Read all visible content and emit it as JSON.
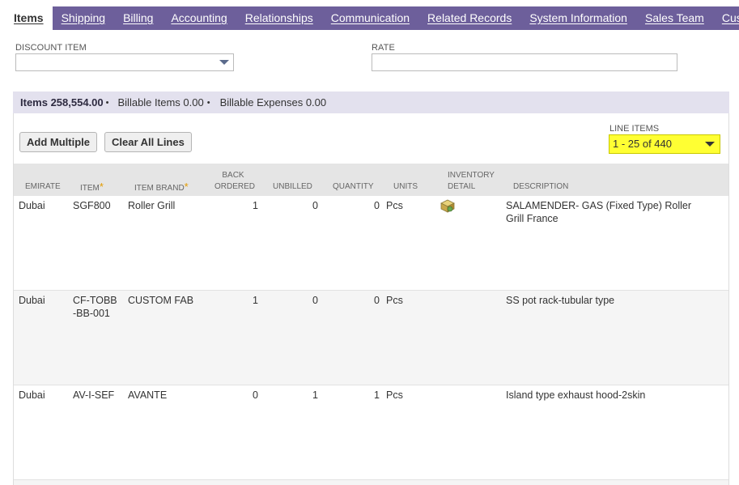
{
  "tabs": [
    "Items",
    "Shipping",
    "Billing",
    "Accounting",
    "Relationships",
    "Communication",
    "Related Records",
    "System Information",
    "Sales Team",
    "Customer"
  ],
  "form": {
    "discount_label": "DISCOUNT ITEM",
    "discount_value": "",
    "rate_label": "RATE",
    "rate_value": ""
  },
  "subtabs": {
    "items": "Items 258,554.00",
    "billable_items": "Billable Items 0.00",
    "billable_expenses": "Billable Expenses 0.00",
    "separator": "•"
  },
  "buttons": {
    "add_multiple": "Add Multiple",
    "clear_all": "Clear All Lines"
  },
  "line_items": {
    "label": "LINE ITEMS",
    "selected": "1 - 25 of 440"
  },
  "columns": {
    "emirate": "EMIRATE",
    "item": "ITEM",
    "item_brand": "ITEM BRAND",
    "back_ordered_1": "BACK",
    "back_ordered_2": "ORDERED",
    "unbilled": "UNBILLED",
    "quantity": "QUANTITY",
    "units": "UNITS",
    "inventory_1": "INVENTORY",
    "inventory_2": "DETAIL",
    "description": "DESCRIPTION",
    "required_mark": "*"
  },
  "rows": [
    {
      "emirate": "Dubai",
      "item": "SGF800",
      "brand": "Roller Grill",
      "back_ordered": "1",
      "unbilled": "0",
      "quantity": "0",
      "units": "Pcs",
      "inventory_icon": "inventory-box-icon",
      "description": "SALAMENDER- GAS (Fixed Type) Roller Grill France"
    },
    {
      "emirate": "Dubai",
      "item": "CF-TOBB-BB-001",
      "brand": "CUSTOM FAB",
      "back_ordered": "1",
      "unbilled": "0",
      "quantity": "0",
      "units": "Pcs",
      "inventory_icon": "",
      "description": "SS pot rack-tubular type"
    },
    {
      "emirate": "Dubai",
      "item": "AV-I-SEF",
      "brand": "AVANTE",
      "back_ordered": "0",
      "unbilled": "1",
      "quantity": "1",
      "units": "Pcs",
      "inventory_icon": "",
      "description": "Island type exhaust hood-2skin"
    }
  ]
}
